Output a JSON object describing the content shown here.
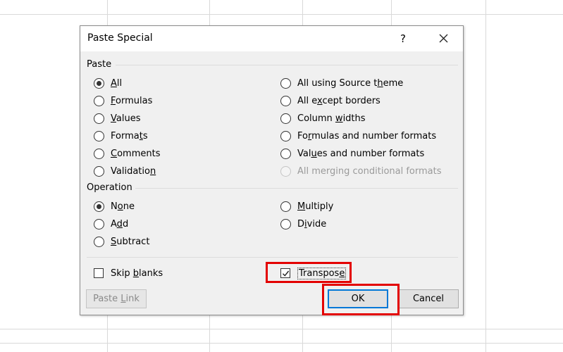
{
  "dialog": {
    "title": "Paste Special",
    "help_label": "?",
    "close_icon": "close-icon"
  },
  "paste": {
    "label": "Paste",
    "options": [
      {
        "pre": "",
        "key": "A",
        "post": "ll",
        "checked": true
      },
      {
        "pre": "",
        "key": "F",
        "post": "ormulas"
      },
      {
        "pre": "",
        "key": "V",
        "post": "alues"
      },
      {
        "pre": "Forma",
        "key": "t",
        "post": "s"
      },
      {
        "pre": "",
        "key": "C",
        "post": "omments"
      },
      {
        "pre": "Validatio",
        "key": "n",
        "post": ""
      },
      {
        "pre": "All using Source t",
        "key": "h",
        "post": "eme"
      },
      {
        "pre": "All e",
        "key": "x",
        "post": "cept borders"
      },
      {
        "pre": "Column ",
        "key": "w",
        "post": "idths"
      },
      {
        "pre": "Fo",
        "key": "r",
        "post": "mulas and number formats"
      },
      {
        "pre": "Val",
        "key": "u",
        "post": "es and number formats"
      },
      {
        "pre": "All mergin",
        "key": "g",
        "post": " conditional formats",
        "disabled": true
      }
    ]
  },
  "operation": {
    "label": "Operation",
    "options": [
      {
        "pre": "N",
        "key": "o",
        "post": "ne",
        "checked": true
      },
      {
        "pre": "A",
        "key": "d",
        "post": "d"
      },
      {
        "pre": "",
        "key": "S",
        "post": "ubtract"
      },
      {
        "pre": "",
        "key": "M",
        "post": "ultiply"
      },
      {
        "pre": "D",
        "key": "i",
        "post": "vide"
      }
    ]
  },
  "skip_blanks": {
    "pre": "Skip ",
    "key": "b",
    "post": "lanks",
    "checked": false
  },
  "transpose": {
    "pre": "Transpos",
    "key": "e",
    "post": "",
    "checked": true
  },
  "buttons": {
    "paste_link": {
      "pre": "Paste ",
      "key": "L",
      "post": "ink",
      "disabled": true
    },
    "ok": "OK",
    "cancel": "Cancel"
  },
  "colors": {
    "highlight": "#e30000",
    "default_button_border": "#0078d7",
    "dialog_bg": "#f0f0f0"
  }
}
